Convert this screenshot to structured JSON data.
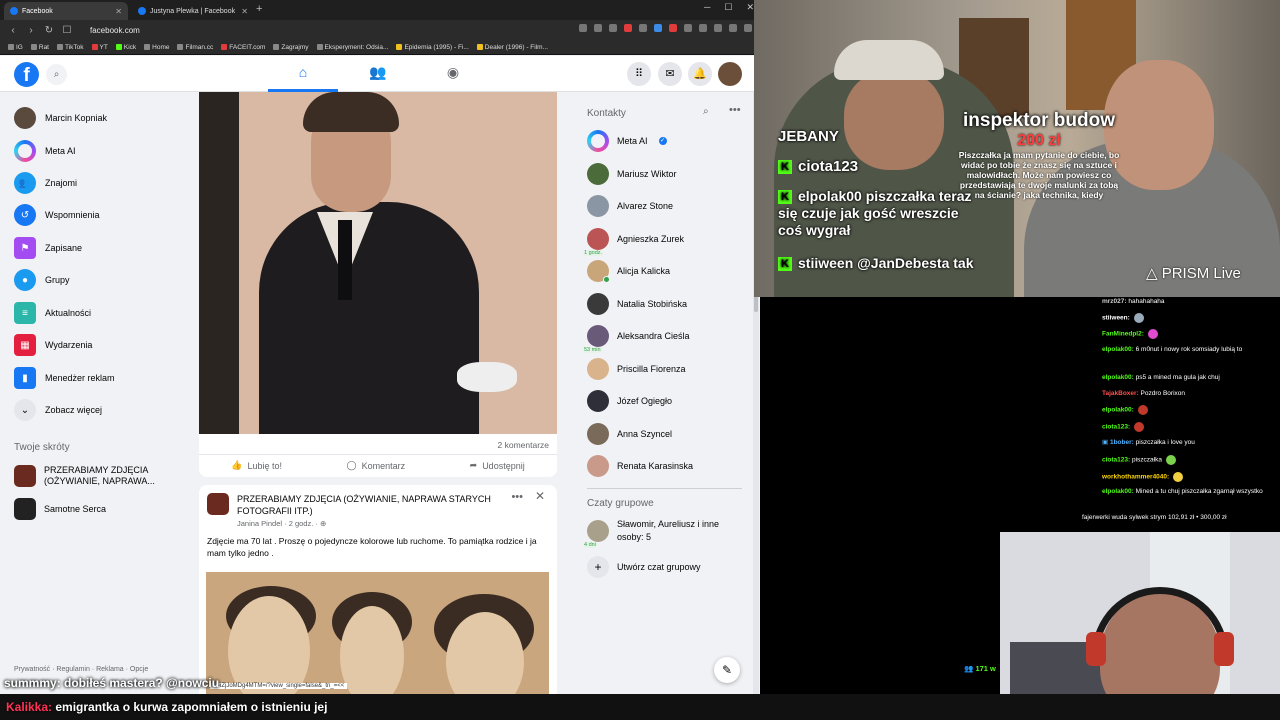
{
  "browser": {
    "tabs": [
      {
        "label": "Facebook"
      },
      {
        "label": "Justyna Plewka | Facebook"
      }
    ],
    "url": "facebook.com",
    "bookmarks": [
      "IG",
      "Rat",
      "TikTok",
      "YT",
      "Kick",
      "Home",
      "Filman.cc",
      "FACEIT.com",
      "Zagrajmy",
      "Eksperyment: Odsia...",
      "Epidemia (1995) - Fi...",
      "Dealer (1996) - Film..."
    ],
    "status_url": "...-iZjJoMDg4MTM=/?view_single=false&_tn_=<<"
  },
  "fb": {
    "logo": "f",
    "left_nav": [
      {
        "label": "Marcin Kopniak",
        "icon": "avatar"
      },
      {
        "label": "Meta AI",
        "icon": "meta-ai-icon"
      },
      {
        "label": "Znajomi",
        "icon": "friends-icon"
      },
      {
        "label": "Wspomnienia",
        "icon": "memories-icon"
      },
      {
        "label": "Zapisane",
        "icon": "saved-icon"
      },
      {
        "label": "Grupy",
        "icon": "groups-icon"
      },
      {
        "label": "Aktualności",
        "icon": "feeds-icon"
      },
      {
        "label": "Wydarzenia",
        "icon": "events-icon"
      },
      {
        "label": "Menedżer reklam",
        "icon": "ads-manager-icon"
      },
      {
        "label": "Zobacz więcej",
        "icon": "chevron-down-icon"
      }
    ],
    "shortcuts_title": "Twoje skróty",
    "shortcuts": [
      {
        "label": "PRZERABIAMY ZDJĘCIA (OŻYWIANIE, NAPRAWA..."
      },
      {
        "label": "Samotne Serca"
      }
    ],
    "footer": "Prywatność · Regulamin · Reklama · Opcje",
    "post1": {
      "comments": "2 komentarze",
      "like": "Lubię to!",
      "comment": "Komentarz",
      "share": "Udostępnij"
    },
    "post2": {
      "title": "PRZERABIAMY ZDJĘCIA (OŻYWIANIE, NAPRAWA STARYCH FOTOGRAFII ITP.)",
      "meta": "Janina Pindel · 2 godz. · ",
      "text": "Zdjęcie ma 70 lat . Proszę o pojedyncze kolorowe lub ruchome. To pamiątka rodzice i ja mam tylko jedno ."
    },
    "contacts_title": "Kontakty",
    "contacts": [
      {
        "name": "Meta AI",
        "online": false,
        "tag": ""
      },
      {
        "name": "Mariusz Wiktor",
        "online": false,
        "tag": ""
      },
      {
        "name": "Alvarez Stone",
        "online": false,
        "tag": ""
      },
      {
        "name": "Agnieszka Zurek",
        "online": false,
        "tag": "1 godz."
      },
      {
        "name": "Alicja Kalicka",
        "online": true,
        "tag": ""
      },
      {
        "name": "Natalia Stobińska",
        "online": false,
        "tag": ""
      },
      {
        "name": "Aleksandra Cieśla",
        "online": false,
        "tag": "53 min"
      },
      {
        "name": "Priscilla Fiorenza",
        "online": false,
        "tag": ""
      },
      {
        "name": "Józef Ogiegło",
        "online": false,
        "tag": ""
      },
      {
        "name": "Anna Szyncel",
        "online": false,
        "tag": ""
      },
      {
        "name": "Renata Karasinska",
        "online": false,
        "tag": ""
      }
    ],
    "group_chats_title": "Czaty grupowe",
    "group_chat": {
      "name": "Sławomir, Aureliusz i inne osoby: 5",
      "tag": "4 dni"
    },
    "create_group": "Utwórz czat grupowy"
  },
  "stream": {
    "overlay_top": "JEBANY",
    "overlay_chat": [
      {
        "text": "ciota123 "
      },
      {
        "text": "elpolak00 piszczałka teraz się czuje jak gość wreszcie coś wygrał"
      },
      {
        "text": "stiiween @JanDebesta  tak"
      }
    ],
    "donation": {
      "name": "inspektor budow",
      "amount": "200 zł",
      "message": "Piszczałka ja mam pytanie do ciebie, bo widać po tobie że znasz się na sztuce i malowidłach. Może nam powiesz co przedstawiają te dwoje malunki za tobą na ścianie? jaka technika, kiedy"
    },
    "prism": "PRISM Live",
    "chat": [
      {
        "user": "mrz027:",
        "msg": "hahahahaha",
        "color": "#cfcfcf"
      },
      {
        "user": "stiiween:",
        "msg": "",
        "color": "#ffffff"
      },
      {
        "user": "FanMinedpl2:",
        "msg": "",
        "color": "#53fc18"
      },
      {
        "user": "elpolak00:",
        "msg": "6 m0nut i nowy rok somsiady lubią to",
        "color": "#53fc18"
      },
      {
        "user": "elpolak00:",
        "msg": "ps5 a mined ma gula jak chuj",
        "color": "#53fc18"
      },
      {
        "user": "TajakBoxer:",
        "msg": "Pozdro Borixon",
        "color": "#ff5050"
      },
      {
        "user": "elpolak00:",
        "msg": "",
        "color": "#53fc18"
      },
      {
        "user": "ciota123:",
        "msg": "",
        "color": "#53fc18"
      },
      {
        "user": "1bober:",
        "msg": "piszczałka i love you",
        "color": "#4fb3ff"
      },
      {
        "user": "ciota123:",
        "msg": "piszczałka",
        "color": "#53fc18"
      },
      {
        "user": "workhothammer4040:",
        "msg": "",
        "color": "#ffd700"
      },
      {
        "user": "elpolak00:",
        "msg": "Mined a tu chuj piszczałka zgarnął wszystko",
        "color": "#53fc18"
      }
    ],
    "ticker": "fajerwerki wuda sylwek strym  102,91 zł  •  300,00 zł",
    "viewers": "171 w",
    "overlay_line": "summmy: dobiłeś mastera? @nowciu",
    "bottom_user": "Kalikka:",
    "bottom_text": "emigrantka o kurwa zapomniałem o istnieniu jej"
  },
  "colors": {
    "fb_blue": "#1877f2",
    "kick_green": "#53fc18"
  }
}
